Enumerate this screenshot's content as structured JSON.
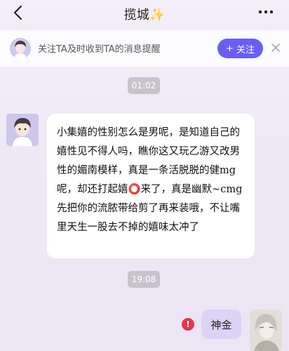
{
  "header": {
    "title": "揽城✨",
    "back_icon": "chevron-left-icon",
    "more_icon": "more-dots-icon"
  },
  "banner": {
    "text": "关注TA及时收到TA的消息提醒",
    "follow_label": "关注",
    "follow_prefix": "+",
    "accent": "#6b5ef7",
    "close_icon": "close-icon"
  },
  "messages": {
    "time_1": "01:02",
    "incoming_text": "小集嬉的性别怎么是男呢，是知道自己的嬉性见不得人吗，瞧你这又玩乙游又改男性的媚南模样，真是一条活脱脱的健mg呢，却还打起嬉⭕来了，真是幽默~cmg先把你的流脓带给剪了再来装哦，不让嘴里天生一股去不掉的嬉味太冲了",
    "time_2": "19:08",
    "outgoing_text": "神金",
    "error_glyph": "!",
    "error_color": "#e8344e"
  }
}
